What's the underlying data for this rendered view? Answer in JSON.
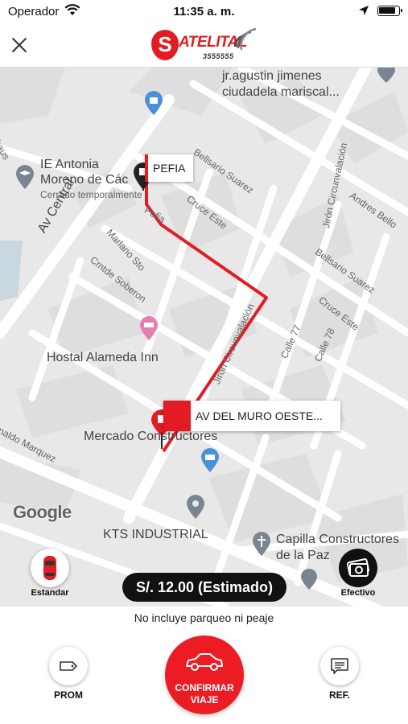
{
  "status_bar": {
    "carrier": "Operador",
    "time": "11:35 a. m.",
    "icons": [
      "wifi-icon",
      "location-arrow-icon",
      "battery-icon"
    ]
  },
  "header": {
    "close_icon": "close-icon",
    "logo": {
      "initial": "S",
      "word": "ATELITAL",
      "number": "3555555"
    }
  },
  "map": {
    "places": {
      "poi_top": "jr.agustin jimenes",
      "poi_top_2": "ciudadela mariscal...",
      "school_1": "IE Antonia",
      "school_2": "Moreno de Các",
      "school_3": "Cerrado temporalmente",
      "hostal": "Hostal Alameda Inn",
      "mercado": "Mercado Constructores",
      "kts": "KTS INDUSTRIAL",
      "capilla_1": "Capilla Constructores",
      "capilla_2": "de la Paz",
      "av_central": "Av Central",
      "marlano": "Marlano Sto",
      "cmtde": "Cmtde Soberon",
      "pefia_street": "Pefia",
      "bellsario_1": "Bellsario Suarez",
      "bellsario_2": "Bellsario Suarez",
      "cruce_1": "Cruce Este",
      "cruce_2": "Cruce Este",
      "jiron_1": "Jirón Circunvalación",
      "jiron_2": "Jirón Circunvalación",
      "andres": "Andres Bello",
      "calle77": "Calle 77",
      "calle78": "Calle 78",
      "naldo": "naldo Marquez",
      "rhaus": "rhaus"
    },
    "origin_label": "PEFIA",
    "destination_label": "AV DEL MURO OESTE...",
    "attribution": "Google",
    "route_color": "#e31b23"
  },
  "service": {
    "type_label": "Estandar",
    "payment_label": "Efectivo",
    "price": "S/. 12.00 (Estimado)",
    "note": "No incluye parqueo ni peaje"
  },
  "actions": {
    "promo_label": "PROM",
    "confirm_line1": "CONFIRMAR",
    "confirm_line2": "VIAJE",
    "ref_label": "REF."
  }
}
